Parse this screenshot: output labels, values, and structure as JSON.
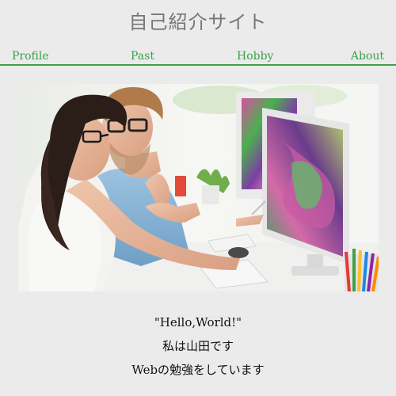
{
  "header": {
    "site_title": "自己紹介サイト"
  },
  "nav": {
    "items": [
      {
        "label": "Profile"
      },
      {
        "label": "Past"
      },
      {
        "label": "Hobby"
      },
      {
        "label": "About"
      }
    ],
    "accent_color": "#3aa14a"
  },
  "intro": {
    "lines": [
      "\"Hello,World!\"",
      "私は山田です",
      "Webの勉強をしています"
    ]
  }
}
